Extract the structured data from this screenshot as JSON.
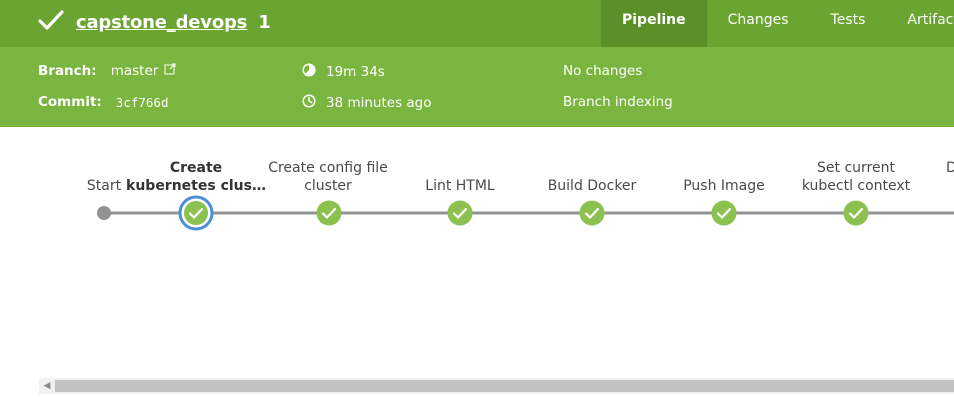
{
  "header": {
    "run_name": "capstone_devops",
    "run_number": "1",
    "tabs": [
      {
        "label": "Pipeline",
        "active": true
      },
      {
        "label": "Changes",
        "active": false
      },
      {
        "label": "Tests",
        "active": false
      },
      {
        "label": "Artifacts",
        "active": false
      }
    ],
    "accent_color": "#6aa431",
    "sub_color": "#7ab63f"
  },
  "summary": {
    "branch_label": "Branch:",
    "branch_value": "master",
    "commit_label": "Commit:",
    "commit_value": "3cf766d",
    "duration": "19m 34s",
    "started": "38 minutes ago",
    "changes": "No changes",
    "cause": "Branch indexing"
  },
  "pipeline": {
    "stages": [
      {
        "name": "Start",
        "status": "start"
      },
      {
        "name": "Create kubernetes clus…",
        "status": "success",
        "selected": true
      },
      {
        "name": "Create config file cluster",
        "status": "success"
      },
      {
        "name": "Lint HTML",
        "status": "success"
      },
      {
        "name": "Build Docker",
        "status": "success"
      },
      {
        "name": "Push Image",
        "status": "success"
      },
      {
        "name": "Set current kubectl context",
        "status": "success"
      },
      {
        "name": "D",
        "status": "success"
      }
    ],
    "success_color": "#8cc04f",
    "selected_ring_color": "#4a90d9"
  }
}
